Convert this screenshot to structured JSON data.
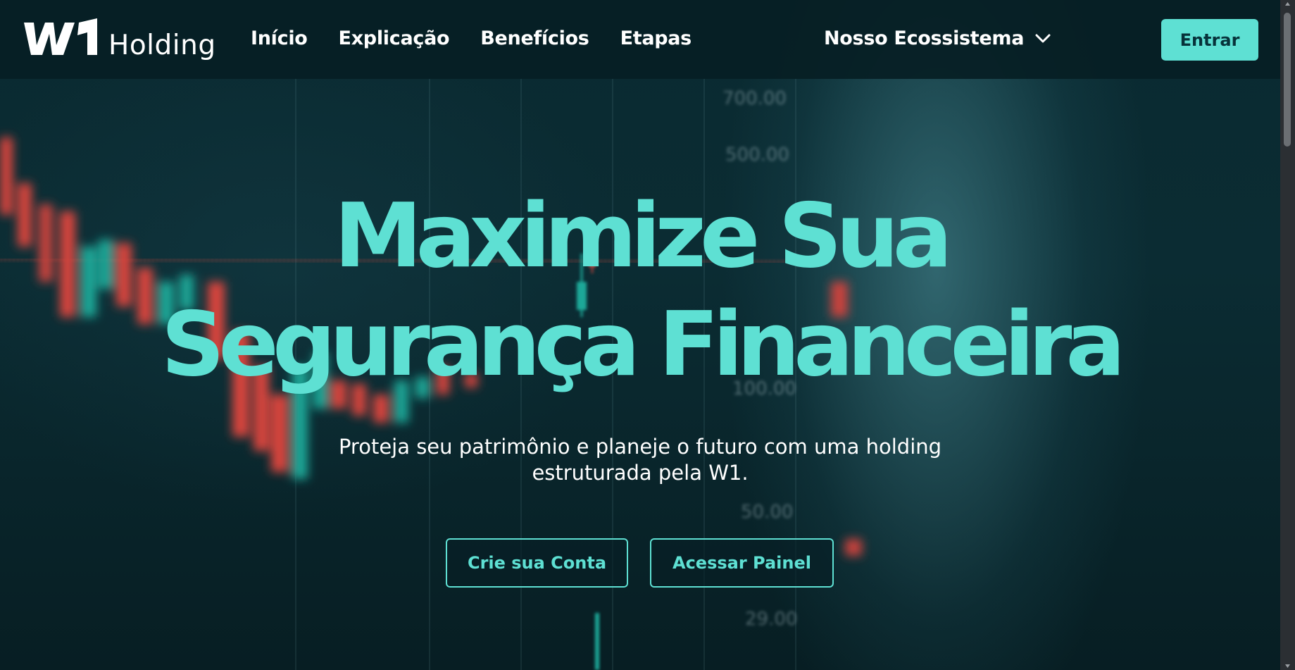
{
  "header": {
    "logo_text": "Holding",
    "logo_mark": "W1",
    "nav": [
      "Início",
      "Explicação",
      "Benefícios",
      "Etapas"
    ],
    "ecosystem_label": "Nosso Ecossistema",
    "login_label": "Entrar"
  },
  "hero": {
    "title_line1": "Maximize Sua",
    "title_line2": "Segurança Financeira",
    "subtitle_line1": "Proteja seu patrimônio e planeje o futuro com uma holding",
    "subtitle_line2": "estruturada pela W1.",
    "cta_primary": "Crie sua Conta",
    "cta_secondary": "Acessar Painel"
  },
  "background": {
    "price_labels": [
      "700.00",
      "500.00",
      "100.00",
      "50.00",
      "29.00"
    ]
  },
  "colors": {
    "accent": "#5ee0d3",
    "header_bg": "#061e24",
    "page_bg": "#061a1f",
    "candle_red": "#e0483f",
    "candle_teal": "#1fb9a8"
  },
  "icons": {
    "dropdown": "chevron-down-icon",
    "logo": "w1-logo-icon"
  }
}
